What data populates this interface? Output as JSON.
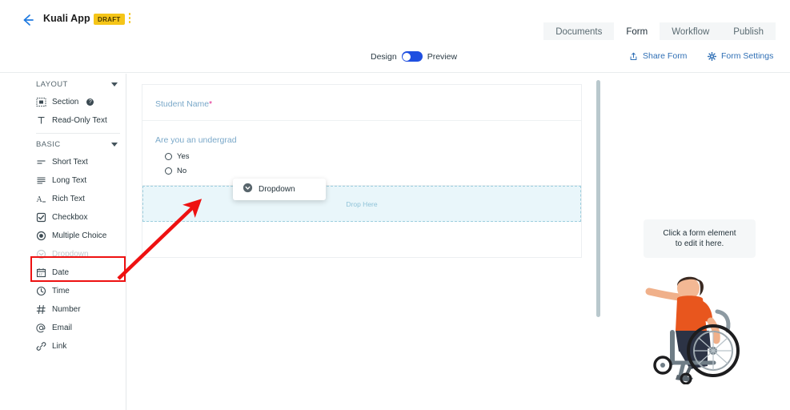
{
  "header": {
    "back_icon": "back-arrow-icon",
    "app_title": "Kuali App",
    "status_badge": "DRAFT",
    "kebab_icon": "kebab-menu-icon",
    "tabs": [
      {
        "label": "Documents",
        "active": false
      },
      {
        "label": "Form",
        "active": true
      },
      {
        "label": "Workflow",
        "active": false
      },
      {
        "label": "Publish",
        "active": false
      }
    ]
  },
  "toolbar": {
    "mode_left_label": "Design",
    "mode_right_label": "Preview",
    "toggle_state": "design",
    "share_form_label": "Share Form",
    "share_icon": "share-upload-icon",
    "form_settings_label": "Form Settings",
    "settings_icon": "gear-icon"
  },
  "palette": {
    "groups": [
      {
        "label": "LAYOUT",
        "caret_icon": "chevron-down-icon",
        "items": [
          {
            "label": "Section",
            "icon": "section-icon",
            "help": "?",
            "state": "normal"
          },
          {
            "label": "Read-Only Text",
            "icon": "text-cursor-icon",
            "state": "normal"
          }
        ]
      },
      {
        "label": "BASIC",
        "caret_icon": "chevron-down-icon",
        "items": [
          {
            "label": "Short Text",
            "icon": "short-text-icon",
            "state": "normal"
          },
          {
            "label": "Long Text",
            "icon": "long-text-icon",
            "state": "normal"
          },
          {
            "label": "Rich Text",
            "icon": "rich-text-icon",
            "state": "normal"
          },
          {
            "label": "Checkbox",
            "icon": "checkbox-icon",
            "state": "normal"
          },
          {
            "label": "Multiple Choice",
            "icon": "radio-icon",
            "state": "normal"
          },
          {
            "label": "Dropdown",
            "icon": "dropdown-icon",
            "state": "dragging"
          },
          {
            "label": "Date",
            "icon": "calendar-icon",
            "state": "normal"
          },
          {
            "label": "Time",
            "icon": "clock-icon",
            "state": "normal"
          },
          {
            "label": "Number",
            "icon": "hash-icon",
            "state": "normal"
          },
          {
            "label": "Email",
            "icon": "at-icon",
            "state": "normal"
          },
          {
            "label": "Link",
            "icon": "link-icon",
            "state": "normal"
          }
        ]
      }
    ]
  },
  "form": {
    "fields": [
      {
        "label": "Student Name",
        "required_marker": "*",
        "type": "short-text"
      },
      {
        "label": "Are you an undergrad",
        "type": "multiple-choice",
        "options": [
          {
            "label": "Yes"
          },
          {
            "label": "No"
          }
        ]
      }
    ],
    "dropzone_text": "Drop Here"
  },
  "drag_ghost": {
    "label": "Dropdown",
    "icon": "dropdown-circle-icon"
  },
  "right_panel": {
    "hint_line_1": "Click a form element",
    "hint_line_2": "to edit it here.",
    "illustration": "person-in-wheelchair-illustration"
  },
  "annotations": {
    "highlight_target": "Dropdown",
    "arrow_icon": "red-arrow-pointer"
  },
  "colors": {
    "accent_blue": "#1f4fe0",
    "link_blue": "#2f6fb5",
    "badge_yellow": "#f5c518",
    "required_pink": "#e0218a",
    "dropzone_blue": "#e9f6fa",
    "annotation_red": "#ee1111"
  }
}
